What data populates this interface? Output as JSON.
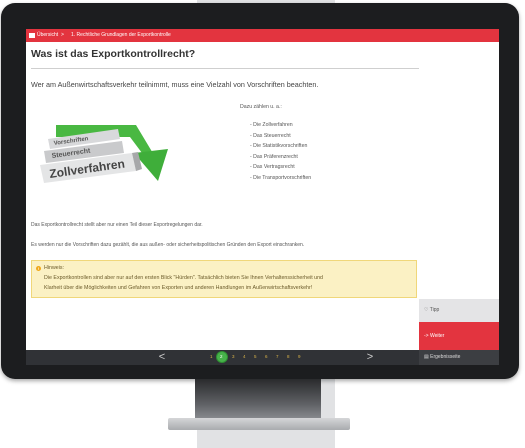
{
  "breadcrumb": {
    "home_label": "Übersicht",
    "separator": ">",
    "current": "1. Rechtliche Grundlagen der Exportkontrolle"
  },
  "page_title": "Was ist das Exportkontrollrecht?",
  "intro": "Wer am Außenwirtschaftsverkehr teilnimmt, muss eine Vielzahl von Vorschriften beachten.",
  "illustration": {
    "labels": [
      "Vorschriften",
      "Steuerrecht",
      "Zollverfahren"
    ],
    "arrow_color": "#3fae3a"
  },
  "list": {
    "intro": "Dazu zählen u. a.:",
    "items": [
      "- Die Zollverfahren",
      "- Das Steuerrecht",
      "- Die Statistikvorschriften",
      "- Das Präferenzrecht",
      "- Das Vertragsrecht",
      "- Die Transportvorschriften"
    ]
  },
  "para1": "Das Exportkontrollrecht stellt aber nur einen Teil dieser Exportregelungen dar.",
  "para2": "Es werden nur die Vorschriften dazu gezählt, die aus außen- oder sicherheitspolitischen Gründen den Export einschranken.",
  "hint": {
    "title": "Hinweis:",
    "line1": "Die Exportkontrollen sind aber nur auf den ersten Blick \"Hürden\". Tatsächlich bieten Sie Ihnen Verhaltenssicherheit und",
    "line2": "Klarheit über die Möglichkeiten und Gefahren von Exporten und anderen Handlungen im Außenwirtschaftsverkehr!"
  },
  "sidebar": {
    "tipp_label": "Tipp",
    "weiter_label": "-> Weiter",
    "results_label": "Ergebnisseite"
  },
  "pager": {
    "prev": "<",
    "next": ">",
    "pages": [
      "1",
      "2",
      "3",
      "4",
      "5",
      "6",
      "7",
      "8",
      "9"
    ],
    "current": "2"
  },
  "colors": {
    "accent": "#e3343f",
    "hint_bg": "#fbf1c4",
    "current_page": "#47b34a"
  }
}
